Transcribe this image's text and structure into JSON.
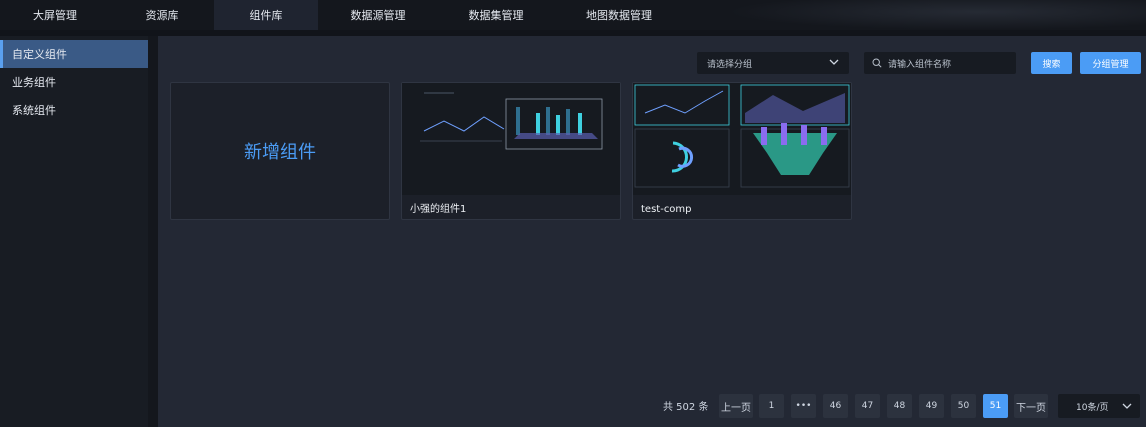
{
  "nav": {
    "tabs": [
      "大屏管理",
      "资源库",
      "组件库",
      "数据源管理",
      "数据集管理",
      "地图数据管理"
    ],
    "active_index": 2
  },
  "sidebar": {
    "items": [
      "自定义组件",
      "业务组件",
      "系统组件"
    ],
    "active_index": 0
  },
  "toolbar": {
    "group_placeholder": "请选择分组",
    "search_placeholder": "请输入组件名称",
    "search_label": "搜索",
    "group_manage_label": "分组管理"
  },
  "cards": {
    "add_label": "新增组件",
    "items": [
      "小强的组件1",
      "test-comp"
    ]
  },
  "pagination": {
    "total_text": "共 502 条",
    "prev_label": "上一页",
    "next_label": "下一页",
    "pages": [
      "1",
      "•••",
      "46",
      "47",
      "48",
      "49",
      "50",
      "51"
    ],
    "current": "51",
    "page_size": "10条/页"
  },
  "colors": {
    "accent": "#4b9cf5",
    "sidebar_active": "#3a5a86"
  }
}
